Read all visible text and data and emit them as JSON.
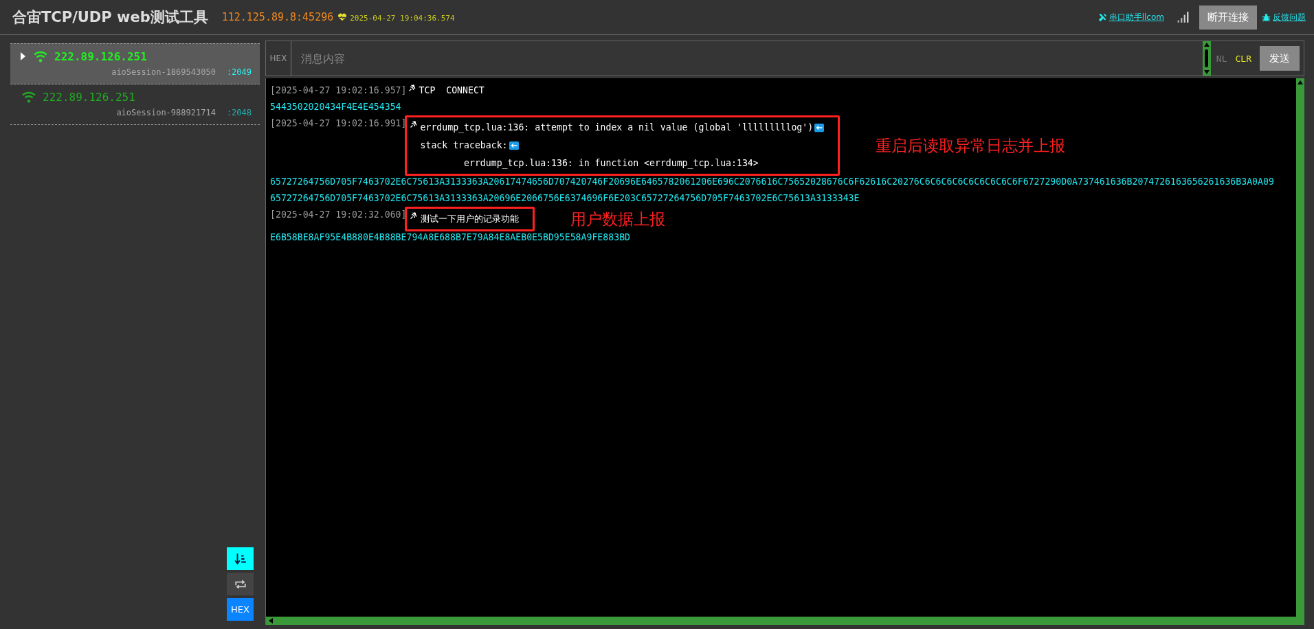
{
  "header": {
    "title": "合宙TCP/UDP web测试工具",
    "address": "112.125.89.8:45296",
    "heartbeat_time": "2025-04-27 19:04:36.574",
    "links": [
      {
        "kind": "tool",
        "label": "串口助手llcom"
      },
      {
        "kind": "bug",
        "label": "反馈问题"
      }
    ],
    "disconnect_button": "断开连接"
  },
  "sessions": [
    {
      "ip": "222.89.126.251",
      "session": "aioSession-1869543050",
      "port": ":2049",
      "selected": true
    },
    {
      "ip": "222.89.126.251",
      "session": "aioSession-988921714",
      "port": ":2048",
      "selected": false
    }
  ],
  "toggles": [
    {
      "kind": "autoscroll",
      "on": true
    },
    {
      "kind": "loop",
      "on": false
    },
    {
      "kind": "hex",
      "label": "HEX",
      "on": true
    }
  ],
  "message_bar": {
    "hex_label": "HEX",
    "placeholder": "消息内容",
    "nl_label": "NL",
    "clr_label": "CLR",
    "send_button": "发送"
  },
  "log": [
    {
      "kind": "entry",
      "time": "[2025-04-27 19:02:16.957]",
      "lines": [
        {
          "text": "TCP  CONNECT",
          "newline_mark": false
        }
      ]
    },
    {
      "kind": "hex",
      "text": "5443502020434F4E4E454354"
    },
    {
      "kind": "entry",
      "time": "[2025-04-27 19:02:16.991]",
      "annotation": "重启后读取异常日志并上报",
      "lines": [
        {
          "text": "errdump_tcp.lua:136: attempt to index a nil value (global 'lllllllllog')",
          "newline_mark": true
        },
        {
          "text": "stack traceback:",
          "newline_mark": true
        },
        {
          "text": "        errdump_tcp.lua:136: in function <errdump_tcp.lua:134>",
          "newline_mark": false
        }
      ]
    },
    {
      "kind": "hex",
      "text": "65727264756D705F7463702E6C75613A3133363A20617474656D707420746F20696E6465782061206E696C2076616C75652028676C6F62616C20276C6C6C6C6C6C6C6C6C6F6727290D0A737461636B2074726163656261636B3A0A09"
    },
    {
      "kind": "hex",
      "text": "65727264756D705F7463702E6C75613A3133363A20696E2066756E6374696F6E203C65727264756D705F7463702E6C75613A3133343E"
    },
    {
      "kind": "entry",
      "time": "[2025-04-27 19:02:32.060]",
      "annotation": "用户数据上报",
      "lines": [
        {
          "text": "测试一下用户的记录功能",
          "newline_mark": false
        }
      ]
    },
    {
      "kind": "hex",
      "text": "E6B58BE8AF95E4B880E4B88BE794A8E688B7E79A84E8AEB0E5BD95E58A9FE883BD"
    }
  ]
}
